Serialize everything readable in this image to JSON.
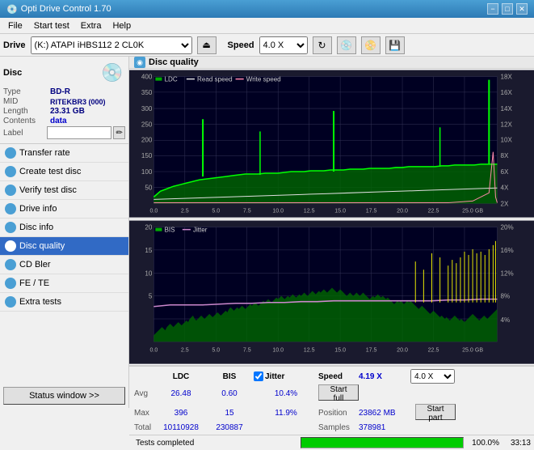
{
  "titleBar": {
    "title": "Opti Drive Control 1.70",
    "minimize": "−",
    "maximize": "□",
    "close": "✕"
  },
  "menuBar": {
    "items": [
      "File",
      "Start test",
      "Extra",
      "Help"
    ]
  },
  "driveBar": {
    "driveLabel": "Drive",
    "driveValue": "(K:) ATAPI iHBS112  2 CL0K",
    "speedLabel": "Speed",
    "speedValue": "4.0 X"
  },
  "discInfo": {
    "sectionLabel": "Disc",
    "fields": [
      {
        "label": "Type",
        "value": "BD-R"
      },
      {
        "label": "MID",
        "value": "RITEKBR3 (000)"
      },
      {
        "label": "Length",
        "value": "23.31 GB"
      },
      {
        "label": "Contents",
        "value": "data"
      },
      {
        "label": "Label",
        "value": ""
      }
    ]
  },
  "navItems": [
    {
      "label": "Transfer rate",
      "active": false
    },
    {
      "label": "Create test disc",
      "active": false
    },
    {
      "label": "Verify test disc",
      "active": false
    },
    {
      "label": "Drive info",
      "active": false
    },
    {
      "label": "Disc info",
      "active": false
    },
    {
      "label": "Disc quality",
      "active": true
    },
    {
      "label": "CD Bler",
      "active": false
    },
    {
      "label": "FE / TE",
      "active": false
    },
    {
      "label": "Extra tests",
      "active": false
    }
  ],
  "statusWindowBtn": "Status window >>",
  "discQuality": {
    "title": "Disc quality",
    "legend1": {
      "ldc": "LDC",
      "readSpeed": "Read speed",
      "writeSpeed": "Write speed"
    },
    "legend2": {
      "bis": "BIS",
      "jitter": "Jitter"
    },
    "yAxisMax1": 400,
    "yAxisRight1Labels": [
      "18X",
      "16X",
      "14X",
      "12X",
      "10X",
      "8X",
      "6X",
      "4X",
      "2X"
    ],
    "yAxisRight2Labels": [
      "20%",
      "16%",
      "12%",
      "8%",
      "4%"
    ],
    "xAxisLabels": [
      "0.0",
      "2.5",
      "5.0",
      "7.5",
      "10.0",
      "12.5",
      "15.0",
      "17.5",
      "20.0",
      "22.5",
      "25.0 GB"
    ]
  },
  "statsPanel": {
    "colHeaders": [
      "LDC",
      "BIS",
      "Jitter",
      "Speed",
      ""
    ],
    "rows": [
      {
        "label": "Avg",
        "ldc": "26.48",
        "bis": "0.60",
        "jitter": "10.4%",
        "speed": "4.19 X"
      },
      {
        "label": "Max",
        "ldc": "396",
        "bis": "15",
        "jitter": "11.9%",
        "position": "23862 MB"
      },
      {
        "label": "Total",
        "ldc": "10110928",
        "bis": "230887",
        "samples": "378981"
      }
    ],
    "jitterChecked": true,
    "speedSelectValue": "4.0 X",
    "startFullBtn": "Start full",
    "startPartBtn": "Start part",
    "positionLabel": "Position",
    "samplesLabel": "Samples"
  },
  "progressBar": {
    "statusText": "Tests completed",
    "percentage": "100.0%",
    "percentNum": 100,
    "time": "33:13"
  }
}
